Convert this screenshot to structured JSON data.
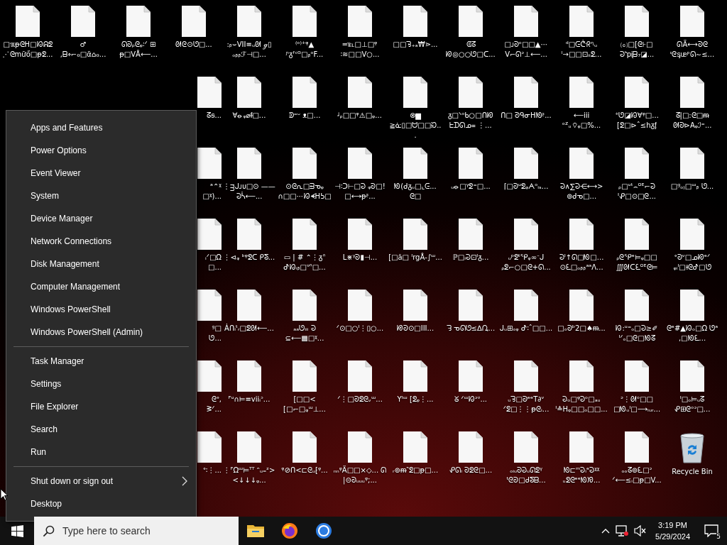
{
  "desktop": {
    "rows": [
      [
        {
          "kind": "file",
          "label": "□ℼᵽᘓᕼ□ᘙᕱᘖ⋰ᘓmữő□ᵽᘖ..."
        },
        {
          "kind": "file",
          "label": "♂ ,ᗷ፥⌐ℴ□ᾱ⌂ℴ..."
        },
        {
          "kind": "file",
          "label": "ᘏᘐᵨᘓᵩ∶ᐟ ⊞ ᵽ□ᐯÅ⟵..."
        },
        {
          "kind": "file",
          "label": "ᘛᘓ⊙ᘎ□..."
        },
        {
          "kind": "file",
          "label": ":ᵦ⌣VII≡ᵤᘛ ℊ▯ ₒᵦᵦℱ⊣□..."
        },
        {
          "kind": "file",
          "label": "⁽ᵒ⁾⁺ᵠ▲ ᶮᵹᶠᶜᴳ□ᵦᵒF..."
        },
        {
          "kind": "file",
          "label": "═℡□⊥□ᵠ ∶≋□□ᐯ○..."
        },
        {
          "kind": "file",
          "label": "□□ᘋ₊ₐ₩⋗..."
        },
        {
          "kind": "file",
          "label": "ᕳᘔ ᘗ◎○○ᘎ□ᑕ..."
        },
        {
          "kind": "file",
          "label": "□ᴊᘐᵒ□□▲⋯ ᐯ⌐ᘏᐣ⊥⟵..."
        },
        {
          "kind": "file",
          "label": "ᵈ□ᕮᕩᖇᶯᵤ ᴵ→□□⊡ᵢᵢᘖ..."
        },
        {
          "kind": "file",
          "label": "⒞□[ᘓ⊦□ ᘒᑋpᶖᗷ₇◪..."
        },
        {
          "kind": "file",
          "label": "ᘏÄ⟷ᘐᘓ ᶦᘓᶊᵫᵖᘏ∼≤..."
        }
      ],
      [
        "",
        "",
        "",
        {
          "kind": "file-partial",
          "label": "ᘔᵴ..."
        },
        {
          "kind": "file",
          "label": "∀⦵ᵩ⌀ᵮ□..."
        },
        {
          "kind": "file",
          "label": "ᕲ⁼ᵕ ᴥ□..."
        },
        {
          "kind": "file",
          "label": "ᶨᵨ□□ᵠ⚠□ᵩ..."
        },
        {
          "kind": "file",
          "label": "⊗▆ ≧ᓎ▯□ᗢ□□ᙊ..."
        },
        {
          "kind": "file",
          "label": "ᵹ□ᐠᵒᑲ○□ᑎᘗ ᖶᗪᘏᓄ᐀ ⋮..."
        },
        {
          "kind": "file",
          "label": "ᑎ□ ᘑᑫᓂᕼᘚᶳ..."
        },
        {
          "kind": "file",
          "label": "⟵iii ᵒᙆᵤ⌔ᵩ□%..."
        },
        {
          "kind": "file",
          "label": "⁺ᘎ◪ᘙ∀ᵠ□... [ᘖ□⊳ˆ≤hᵹᶂ"
        },
        {
          "kind": "file",
          "label": "ᘔ|□:ᘓ□ᵯ ᘛᘐ⊳Aᵩℐ⁼..."
        }
      ],
      [
        "",
        "",
        "",
        {
          "kind": "file-partial",
          "label": "ᵃ⌃ᵡ □ᵡ)..."
        },
        {
          "kind": "file",
          "label": "⋮ᴟᒍᴊᴜ□⊙ ——ᘒᓵ⟵..."
        },
        {
          "kind": "file",
          "label": "⊙ᘓᕆ□ᗲᓀᵩ ∩□□⋯ᘙᗛᕼᕊ□"
        },
        {
          "kind": "file",
          "label": "⊣∶ᑐ⊢□ᘒ ᵩᘐ□!□⟷ᵽᶳ..."
        },
        {
          "kind": "file",
          "label": "ᘚ(ᑯᵹᵤ□⌞ᕮ... ᘓ□"
        },
        {
          "kind": "file",
          "label": "ᵤ⦵□ᵞᘖ⁼□..."
        },
        {
          "kind": "file",
          "label": "⌈□ᘐᵘᘖᵩᗅᵒᵢₛ..."
        },
        {
          "kind": "file",
          "label": "ᘒ∧∑ᘒ⋲⟷> ⊚ᑯᓀ□..."
        },
        {
          "kind": "file",
          "label": "ᵨ□ᵘᵗ⌢ᴼᴱ⌐ᘒ ᑊᕵ□⊙□ᘓ..."
        },
        {
          "kind": "file",
          "label": "□ᵍₒ₎□ᵚᵦ ᘎ..."
        }
      ],
      [
        "",
        "",
        "",
        {
          "kind": "file-partial",
          "label": "ᵢᐟ□Ω □..."
        },
        {
          "kind": "file",
          "label": "⋮⊲ᵩ ᵇᵠᘖᑕ ᑭᘕ..."
        },
        {
          "kind": "file",
          "label": "▭ | # ⌃⋮ᵹᐢ ᕷᘙᵢᵦ□ᐡᐢ□..."
        },
        {
          "kind": "file",
          "label": "ᒪ⋇ᵞᘐ▮⊣..."
        },
        {
          "kind": "file",
          "label": "[□ă□ ᑊrgÅ-∫ᵚ..."
        },
        {
          "kind": "file",
          "label": "ℙ□ᵢᘒ⊡ᑊᵹ..."
        },
        {
          "kind": "file",
          "label": "ᵤᵖᘖᵗᕿᵩ∞ᐨᒍ ᵨᘖ⌐○□ᘓ+ᘏ..."
        },
        {
          "kind": "file",
          "label": "ᘒᑊ↑ᘏ□ᘚ□... ⊙ᘍ□ₒᵦᵦᵃᵃᐱ..."
        },
        {
          "kind": "file",
          "label": "ᵨᘓᕿᵉ⊨ᵩ□□ ∭ᘛᑕ̈ᘍᴼᴱᘓ⊨"
        },
        {
          "kind": "file",
          "label": "ᐤᘐᵛ□ᓄᘗᵉᐟ ᵩᵢᑊ□⫲ᘓᕷ□ᘎ"
        }
      ],
      [
        "",
        "",
        "",
        {
          "kind": "file-partial",
          "label": "ᵍ□ ᘎ..."
        },
        {
          "kind": "file",
          "label": "Ȧᑎᵢᵗᵣ□ᘖᘛ⟵..."
        },
        {
          "kind": "file",
          "label": "ₐₐᘎᵢᵢᵢ ᘒ ⊆⟵▩□ᵡ..."
        },
        {
          "kind": "file",
          "label": "ᐟ⊙□○ᑊ⋮▯○..."
        },
        {
          "kind": "file",
          "label": "ᘘᘐ⊙□III..."
        },
        {
          "kind": "file",
          "label": "ᘌ ᓀᘏᘎ≤∆ᘩ..."
        },
        {
          "kind": "file",
          "label": "ᒍᵤ⊞ₒᵩ ᕷ∶ˆ□□..."
        },
        {
          "kind": "file",
          "label": "□ₒᘐᵇ2□♠ᵯ..."
        },
        {
          "kind": "file",
          "label": "ᘙ:ᵘ⁼ₒ□ᘒ≥✐ ᑊᐟₒ□ᘓ□ᘚᘔ"
        },
        {
          "kind": "file",
          "label": "ᘓᵉ#▲ᘙₒ□Ω ᘎᵃ ,□ᘚᘍ..."
        }
      ],
      [
        "",
        "",
        "",
        {
          "kind": "file-partial",
          "label": "ᘓᐤ, ᕒᐟ..."
        },
        {
          "kind": "file",
          "label": "ᴾᵘ∩⊨≡viiᵢᵓ..."
        },
        {
          "kind": "file",
          "label": "[□□< [□⌐□ᵩᵚ⊥..."
        },
        {
          "kind": "file",
          "label": "ᐟ⋮□ᘐᘖᘓᵥᵚ..."
        },
        {
          "kind": "file",
          "label": "Yᑊᵚ [ᘖᵩ⋮..."
        },
        {
          "kind": "file",
          "label": "ᘜ ᐟᵚᘙᐣᐡ..."
        },
        {
          "kind": "file",
          "label": "ᵤᘋ□ᘐᵉᵉT∂ᵛ ᐟᘖ□⋮⋮ᵽᘓᵢ..."
        },
        {
          "kind": "file",
          "label": "ᘒₒ□ᵠᘒᵒ□ₐᵤ ᑊ≛Hᵩ□□ₒ□□..."
        },
        {
          "kind": "file",
          "label": "ᐣ⋮ᘛᵒ□□ □ᘚᵤᑊ□⟶ᵢᵤᵣ..."
        },
        {
          "kind": "file",
          "label": "ᑊ□ₒ⊨ᵤᘔ ᕵ⊞ᘓᵒᐣ□..."
        }
      ],
      [
        "",
        "",
        "",
        {
          "kind": "file-partial",
          "label": "ᐤ∶⋮..."
        },
        {
          "kind": "file",
          "label": "⋮ᴾΩᵚ⊨ᵀᵀ ᵔᵤ₌ᶻ><↓↓↓ᵩ..."
        },
        {
          "kind": "file",
          "label": "ᵠ⊘ᑎ<⊏ᘓᵤ⁅ᵠ..."
        },
        {
          "kind": "file",
          "label": "ₙₙᵠÄ□□⨯◇... ᘏ |⊝ᘐᵤᵤᵤᵠ;..."
        },
        {
          "kind": "file",
          "label": "ᵣ⊚ᵯ‶ᘖ□ᵽ□..."
        },
        {
          "kind": "file",
          "label": "ᕵᘏᵢ ᘐᘖᘓ□..."
        },
        {
          "kind": "file",
          "label": "ₒᵢᵤᘐᘒᵤᘏᘖᵞ ᵗᘓᘐ□ᑯᘕᗷ..."
        },
        {
          "kind": "file",
          "label": "ᘚ⊏ᵐᘒᵢᵉᘒᵡᵡ ᵤᘖᘓᵉᵉᘚᘞ..."
        },
        {
          "kind": "file",
          "label": "ₒₒᘔ⊚ᘍ□ᐣ ᐟ⟵≤ᵢ□ᵽ□V..."
        },
        {
          "kind": "recycle-bin",
          "label": "Recycle Bin"
        }
      ]
    ]
  },
  "menu": {
    "groups": [
      [
        {
          "label": "Apps and Features",
          "submenu": false
        },
        {
          "label": "Power Options",
          "submenu": false
        },
        {
          "label": "Event Viewer",
          "submenu": false
        },
        {
          "label": "System",
          "submenu": false
        },
        {
          "label": "Device Manager",
          "submenu": false
        },
        {
          "label": "Network Connections",
          "submenu": false
        },
        {
          "label": "Disk Management",
          "submenu": false
        },
        {
          "label": "Computer Management",
          "submenu": false
        },
        {
          "label": "Windows PowerShell",
          "submenu": false
        },
        {
          "label": "Windows PowerShell (Admin)",
          "submenu": false
        }
      ],
      [
        {
          "label": "Task Manager",
          "submenu": false
        },
        {
          "label": "Settings",
          "submenu": false
        },
        {
          "label": "File Explorer",
          "submenu": false
        },
        {
          "label": "Search",
          "submenu": false
        },
        {
          "label": "Run",
          "submenu": false
        }
      ],
      [
        {
          "label": "Shut down or sign out",
          "submenu": true
        },
        {
          "label": "Desktop",
          "submenu": false
        }
      ]
    ]
  },
  "taskbar": {
    "search": {
      "placeholder": "Type here to search"
    },
    "apps": [
      {
        "kind": "file-explorer"
      },
      {
        "kind": "firefox"
      },
      {
        "kind": "chrome"
      }
    ],
    "clock": {
      "time": "3:19 PM",
      "date": "5/29/2024"
    },
    "notifications": {
      "count": "5"
    }
  }
}
